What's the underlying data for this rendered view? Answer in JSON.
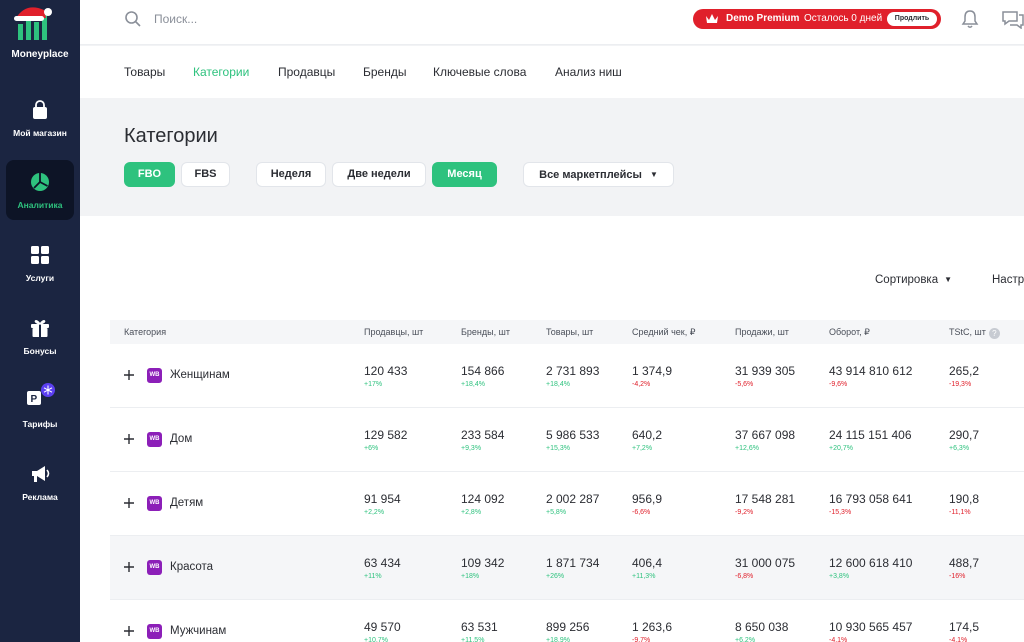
{
  "app": {
    "name": "Moneyplace"
  },
  "sidebar": {
    "items": [
      {
        "label": "Мой магазин",
        "icon": "shopping-bag-icon"
      },
      {
        "label": "Аналитика",
        "icon": "pie-chart-icon",
        "active": true
      },
      {
        "label": "Услуги",
        "icon": "grid-icon"
      },
      {
        "label": "Бонусы",
        "icon": "gift-icon"
      },
      {
        "label": "Тарифы",
        "icon": "tariff-badge-icon"
      },
      {
        "label": "Реклама",
        "icon": "megaphone-icon"
      }
    ]
  },
  "header": {
    "search_placeholder": "Поиск...",
    "premium": {
      "title": "Demo Premium",
      "days_left": "Осталось 0 дней",
      "extend_label": "Продлить"
    }
  },
  "tabs": [
    {
      "label": "Товары"
    },
    {
      "label": "Категории",
      "active": true
    },
    {
      "label": "Продавцы"
    },
    {
      "label": "Бренды"
    },
    {
      "label": "Ключевые слова"
    },
    {
      "label": "Анализ ниш"
    }
  ],
  "page": {
    "title": "Категории",
    "filters": {
      "fbo": "FBO",
      "fbs": "FBS",
      "week": "Неделя",
      "two_weeks": "Две недели",
      "month": "Месяц",
      "marketplaces": "Все маркетплейсы"
    },
    "sort_label": "Сортировка",
    "settings_label": "Настр"
  },
  "table": {
    "columns": [
      "Категория",
      "Продавцы, шт",
      "Бренды, шт",
      "Товары, шт",
      "Средний чек, ₽",
      "Продажи, шт",
      "Оборот, ₽",
      "TStC, шт"
    ],
    "rows": [
      {
        "badge": "WB",
        "name": "Женщинам",
        "cells": [
          {
            "v": "120 433",
            "d": "+17%"
          },
          {
            "v": "154 866",
            "d": "+18,4%"
          },
          {
            "v": "2 731 893",
            "d": "+18,4%"
          },
          {
            "v": "1 374,9",
            "d": "-4,2%"
          },
          {
            "v": "31 939 305",
            "d": "-5,6%"
          },
          {
            "v": "43 914 810 612",
            "d": "-9,6%"
          },
          {
            "v": "265,2",
            "d": "-19,3%"
          }
        ]
      },
      {
        "badge": "WB",
        "name": "Дом",
        "cells": [
          {
            "v": "129 582",
            "d": "+6%"
          },
          {
            "v": "233 584",
            "d": "+9,3%"
          },
          {
            "v": "5 986 533",
            "d": "+15,3%"
          },
          {
            "v": "640,2",
            "d": "+7,2%"
          },
          {
            "v": "37 667 098",
            "d": "+12,6%"
          },
          {
            "v": "24 115 151 406",
            "d": "+20,7%"
          },
          {
            "v": "290,7",
            "d": "+6,3%"
          }
        ]
      },
      {
        "badge": "WB",
        "name": "Детям",
        "cells": [
          {
            "v": "91 954",
            "d": "+2,2%"
          },
          {
            "v": "124 092",
            "d": "+2,8%"
          },
          {
            "v": "2 002 287",
            "d": "+5,8%"
          },
          {
            "v": "956,9",
            "d": "-6,6%"
          },
          {
            "v": "17 548 281",
            "d": "-9,2%"
          },
          {
            "v": "16 793 058 641",
            "d": "-15,3%"
          },
          {
            "v": "190,8",
            "d": "-11,1%"
          }
        ]
      },
      {
        "badge": "WB",
        "name": "Красота",
        "cells": [
          {
            "v": "63 434",
            "d": "+11%"
          },
          {
            "v": "109 342",
            "d": "+18%"
          },
          {
            "v": "1 871 734",
            "d": "+26%"
          },
          {
            "v": "406,4",
            "d": "+11,3%"
          },
          {
            "v": "31 000 075",
            "d": "-6,8%"
          },
          {
            "v": "12 600 618 410",
            "d": "+3,8%"
          },
          {
            "v": "488,7",
            "d": "-16%"
          }
        ]
      },
      {
        "badge": "WB",
        "name": "Мужчинам",
        "cells": [
          {
            "v": "49 570",
            "d": "+10,7%"
          },
          {
            "v": "63 531",
            "d": "+11,5%"
          },
          {
            "v": "899 256",
            "d": "+18,9%"
          },
          {
            "v": "1 263,6",
            "d": "-9,7%"
          },
          {
            "v": "8 650 038",
            "d": "+6,2%"
          },
          {
            "v": "10 930 565 457",
            "d": "-4,1%"
          },
          {
            "v": "174,5",
            "d": "-4,1%"
          }
        ]
      }
    ]
  },
  "colors": {
    "accent": "#2ec27e",
    "sidebar": "#1b2541",
    "premium": "#e0202b",
    "negative": "#e0202b",
    "wb_badge": "#8c1fb8"
  }
}
